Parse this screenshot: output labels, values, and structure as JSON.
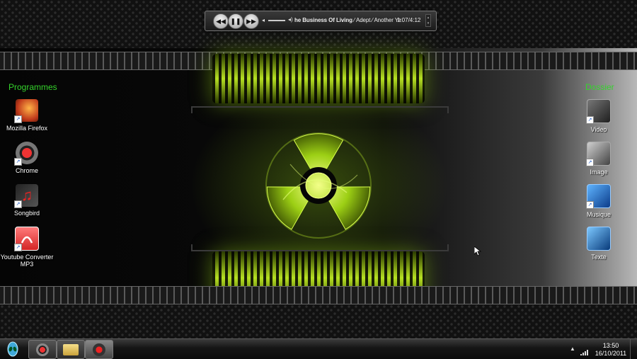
{
  "player": {
    "track_title": "he Business Of Living",
    "separator1": " ⁄ ",
    "artist": "Adept",
    "separator2": " ⁄ ",
    "album": "Another Ye",
    "time": "1:07/4:12"
  },
  "groups": {
    "left_label": "Programmes",
    "right_label": "Dossier"
  },
  "left_icons": [
    {
      "label": "Mozilla Firefox"
    },
    {
      "label": "Chrome"
    },
    {
      "label": "Songbird"
    },
    {
      "label": "Youtube Converter MP3"
    }
  ],
  "right_icons": [
    {
      "label": "Video"
    },
    {
      "label": "Image"
    },
    {
      "label": "Musique"
    },
    {
      "label": "Texte"
    }
  ],
  "taskbar": {
    "time": "13:50",
    "date": "16/10/2011"
  },
  "colors": {
    "accent_green": "#35d42c",
    "glow_green": "#b6e022"
  }
}
